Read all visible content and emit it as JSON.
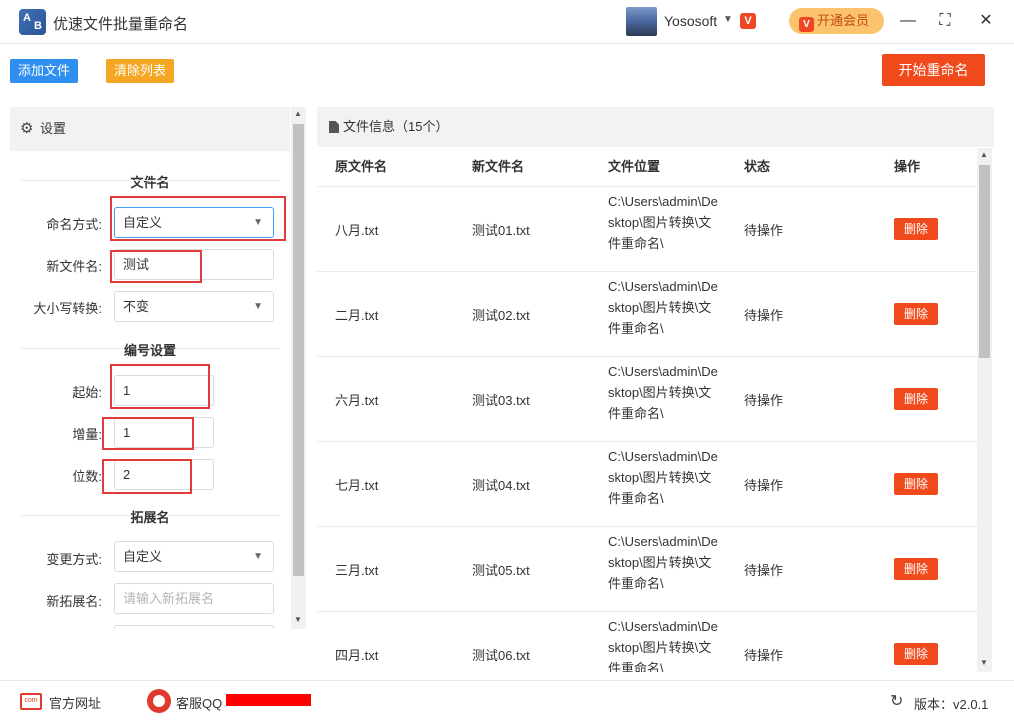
{
  "app": {
    "title": "优速文件批量重命名",
    "logo_text_a": "A",
    "logo_text_b": "B"
  },
  "user": {
    "name": "Yososoft",
    "brand_mark": "V"
  },
  "vip": {
    "label": "开通会员",
    "mark": "V"
  },
  "window": {
    "minimize": "—",
    "maximize": "⛶",
    "close": "✕"
  },
  "toolbar": {
    "add": "添加文件",
    "clear": "清除列表",
    "start": "开始重命名"
  },
  "settings": {
    "title": "设置",
    "filename": {
      "section": "文件名",
      "mode_label": "命名方式:",
      "mode_value": "自定义",
      "newname_label": "新文件名:",
      "newname_value": "测试",
      "case_label": "大小写转换:",
      "case_value": "不变"
    },
    "numbering": {
      "section": "编号设置",
      "start_label": "起始:",
      "start_value": "1",
      "step_label": "增量:",
      "step_value": "1",
      "digits_label": "位数:",
      "digits_value": "2"
    },
    "extension": {
      "section": "拓展名",
      "mode_label": "变更方式:",
      "mode_value": "自定义",
      "newext_label": "新拓展名:",
      "newext_placeholder": "请输入新拓展名"
    }
  },
  "files": {
    "title": "文件信息（15个）",
    "columns": [
      "原文件名",
      "新文件名",
      "文件位置",
      "状态",
      "操作"
    ],
    "rows": [
      {
        "orig": "八月.txt",
        "new": "测试01.txt",
        "path": "C:\\Users\\admin\\Desktop\\图片转换\\文件重命名\\",
        "status": "待操作",
        "action": "删除"
      },
      {
        "orig": "二月.txt",
        "new": "测试02.txt",
        "path": "C:\\Users\\admin\\Desktop\\图片转换\\文件重命名\\",
        "status": "待操作",
        "action": "删除"
      },
      {
        "orig": "六月.txt",
        "new": "测试03.txt",
        "path": "C:\\Users\\admin\\Desktop\\图片转换\\文件重命名\\",
        "status": "待操作",
        "action": "删除"
      },
      {
        "orig": "七月.txt",
        "new": "测试04.txt",
        "path": "C:\\Users\\admin\\Desktop\\图片转换\\文件重命名\\",
        "status": "待操作",
        "action": "删除"
      },
      {
        "orig": "三月.txt",
        "new": "测试05.txt",
        "path": "C:\\Users\\admin\\Desktop\\图片转换\\文件重命名\\",
        "status": "待操作",
        "action": "删除"
      },
      {
        "orig": "四月.txt",
        "new": "测试06.txt",
        "path": "C:\\Users\\admin\\Desktop\\图片转换\\文件重命名\\",
        "status": "待操作",
        "action": "删除"
      }
    ]
  },
  "footer": {
    "website": "官方网址",
    "website_icon_text": "com",
    "support": "客服QQ",
    "version": "版本：v2.0.1"
  },
  "icons": {
    "dropdown": "chevron-down-icon",
    "refresh": "↻",
    "gear": "⚙"
  },
  "colors": {
    "accent": "#f04a1c",
    "add": "#2f8ff0",
    "clear": "#f5a623",
    "vip": "#fbc36b",
    "highlight": "#e23b3b"
  }
}
